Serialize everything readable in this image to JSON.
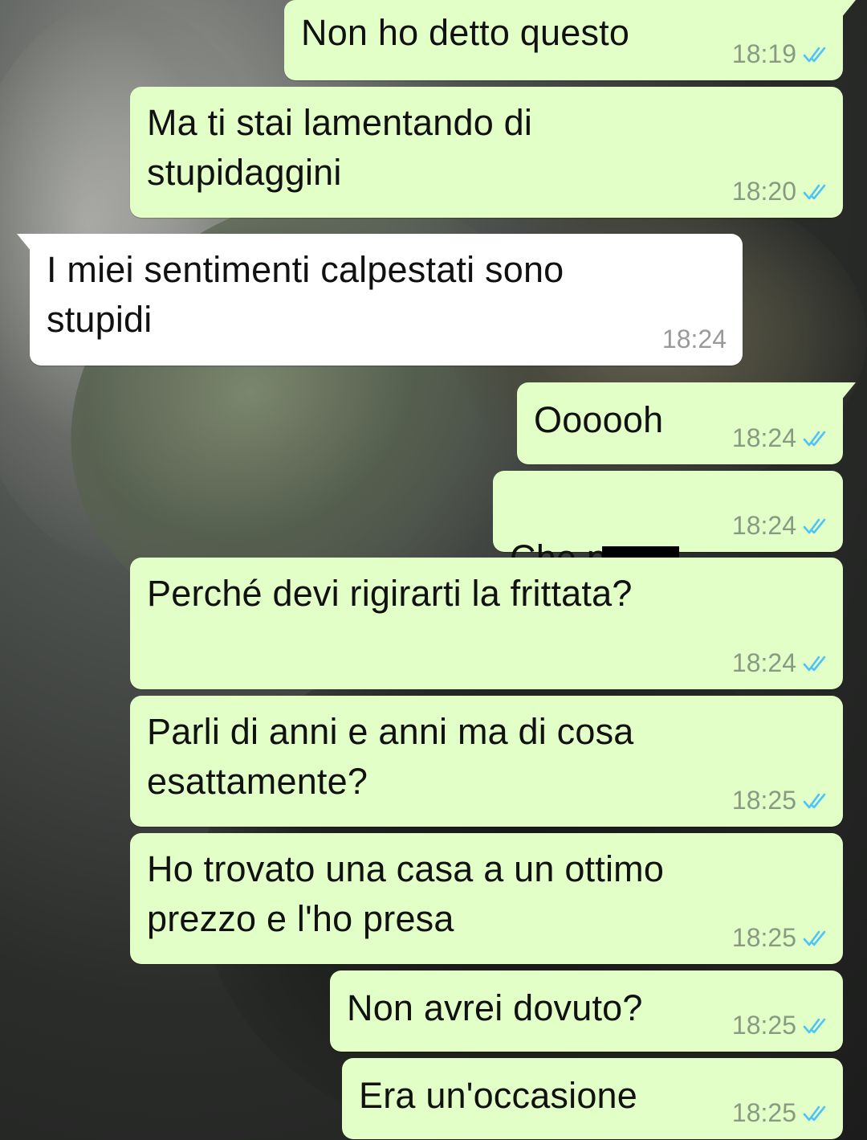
{
  "colors": {
    "outgoing_bubble": "#e1ffc7",
    "incoming_bubble": "#ffffff",
    "read_ticks": "#4fc3f7"
  },
  "messages": [
    {
      "text": "Non ho detto questo",
      "time": "18:19",
      "direction": "outgoing",
      "status": "read"
    },
    {
      "text": "Ma ti stai lamentando di\nstupidaggini",
      "time": "18:20",
      "direction": "outgoing",
      "status": "read"
    },
    {
      "text": "I miei sentimenti calpestati sono\nstupidi",
      "time": "18:24",
      "direction": "incoming"
    },
    {
      "text": "Oooooh",
      "time": "18:24",
      "direction": "outgoing",
      "status": "read"
    },
    {
      "text": "Che p",
      "time": "18:24",
      "direction": "outgoing",
      "status": "read",
      "redacted": true
    },
    {
      "text": "Perché devi rigirarti la frittata?",
      "time": "18:24",
      "direction": "outgoing",
      "status": "read"
    },
    {
      "text": "Parli di anni e anni ma di cosa\nesattamente?",
      "time": "18:25",
      "direction": "outgoing",
      "status": "read"
    },
    {
      "text": "Ho trovato una casa a un ottimo\nprezzo e l'ho presa",
      "time": "18:25",
      "direction": "outgoing",
      "status": "read"
    },
    {
      "text": "Non avrei dovuto?",
      "time": "18:25",
      "direction": "outgoing",
      "status": "read"
    },
    {
      "text": "Era un'occasione",
      "time": "18:25",
      "direction": "outgoing",
      "status": "read"
    }
  ]
}
